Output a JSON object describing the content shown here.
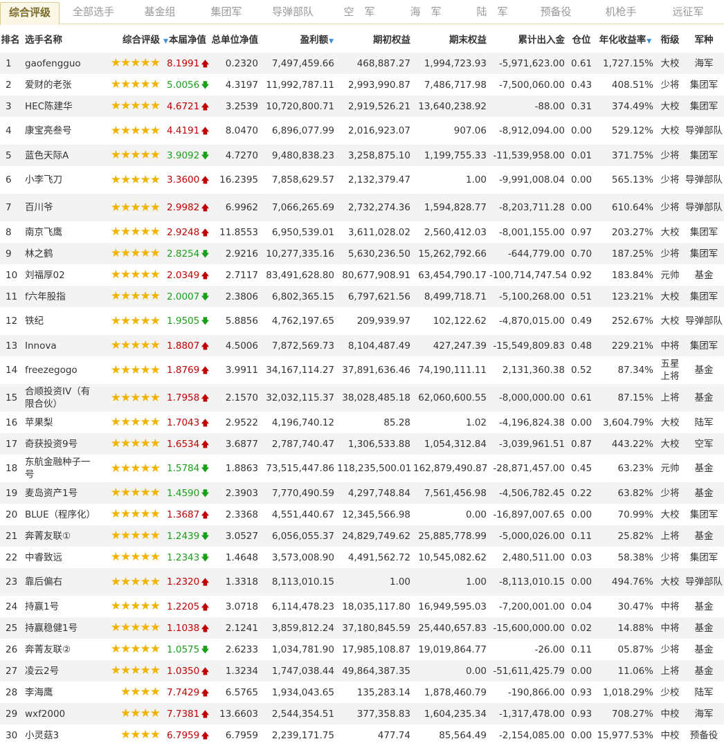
{
  "tabs": [
    "综合评级",
    "全部选手",
    "基金组",
    "集团军",
    "导弹部队",
    "空　军",
    "海　军",
    "陆　军",
    "预备役",
    "机枪手",
    "远征军"
  ],
  "headers": {
    "rank": "排名",
    "name": "选手名称",
    "rating": "综合评级",
    "nav": "本届净值",
    "total_nav": "总单位净值",
    "profit": "盈利额",
    "start_equity": "期初权益",
    "end_equity": "期末权益",
    "net_flow": "累计出入金",
    "position": "仓位",
    "annual": "年化收益率",
    "rank_title": "衔级",
    "branch": "军种"
  },
  "sort_arrow": "▼",
  "icons": {
    "star": "★",
    "up": "🡅",
    "down": "🡇"
  },
  "colors": {
    "up": "#c00000",
    "down": "#19a019",
    "star": "#f0b400"
  },
  "rows": [
    {
      "rank": "1",
      "name": "gaofengguo",
      "stars": 5,
      "nav": "8.1991",
      "dir": "up",
      "total_nav": "0.2320",
      "profit": "7,497,459.66",
      "start": "468,887.27",
      "end": "1,994,723.93",
      "flow": "-5,971,623.00",
      "pos": "0.61",
      "annual": "1,727.15%",
      "title": "大校",
      "branch": "海军"
    },
    {
      "rank": "2",
      "name": "爱财的老张",
      "stars": 5,
      "nav": "5.0056",
      "dir": "down",
      "total_nav": "4.3197",
      "profit": "11,992,787.11",
      "start": "2,993,990.87",
      "end": "7,486,717.98",
      "flow": "-7,500,060.00",
      "pos": "0.43",
      "annual": "408.51%",
      "title": "少将",
      "branch": "集团军"
    },
    {
      "rank": "3",
      "name": "HEC陈建华",
      "stars": 5,
      "nav": "4.6721",
      "dir": "up",
      "total_nav": "3.2539",
      "profit": "10,720,800.71",
      "start": "2,919,526.21",
      "end": "13,640,238.92",
      "flow": "-88.00",
      "pos": "0.31",
      "annual": "374.49%",
      "title": "大校",
      "branch": "集团军"
    },
    {
      "rank": "4",
      "name": "康宝亮叁号",
      "stars": 5,
      "nav": "4.4191",
      "dir": "up",
      "total_nav": "8.0470",
      "profit": "6,896,077.99",
      "start": "2,016,923.07",
      "end": "907.06",
      "flow": "-8,912,094.00",
      "pos": "0.00",
      "annual": "529.12%",
      "title": "大校",
      "branch": "导弹部队"
    },
    {
      "rank": "5",
      "name": "蓝色天际A",
      "stars": 5,
      "nav": "3.9092",
      "dir": "down",
      "total_nav": "4.7270",
      "profit": "9,480,838.23",
      "start": "3,258,875.10",
      "end": "1,199,755.33",
      "flow": "-11,539,958.00",
      "pos": "0.01",
      "annual": "371.75%",
      "title": "少将",
      "branch": "集团军"
    },
    {
      "rank": "6",
      "name": "小李飞刀",
      "stars": 5,
      "nav": "3.3600",
      "dir": "up",
      "total_nav": "16.2395",
      "profit": "7,858,629.57",
      "start": "2,132,379.47",
      "end": "1.00",
      "flow": "-9,991,008.04",
      "pos": "0.00",
      "annual": "565.13%",
      "title": "少将",
      "branch": "导弹部队"
    },
    {
      "rank": "7",
      "name": "百川爷",
      "stars": 5,
      "nav": "2.9982",
      "dir": "up",
      "total_nav": "6.9962",
      "profit": "7,066,265.69",
      "start": "2,732,274.36",
      "end": "1,594,828.77",
      "flow": "-8,203,711.28",
      "pos": "0.00",
      "annual": "610.64%",
      "title": "少将",
      "branch": "导弹部队"
    },
    {
      "rank": "8",
      "name": "南京飞鹰",
      "stars": 5,
      "nav": "2.9248",
      "dir": "up",
      "total_nav": "11.8553",
      "profit": "6,950,539.01",
      "start": "3,611,028.02",
      "end": "2,560,412.03",
      "flow": "-8,001,155.00",
      "pos": "0.97",
      "annual": "203.27%",
      "title": "大校",
      "branch": "集团军"
    },
    {
      "rank": "9",
      "name": "林之鹤",
      "stars": 5,
      "nav": "2.8254",
      "dir": "down",
      "total_nav": "2.9216",
      "profit": "10,277,335.16",
      "start": "5,630,236.50",
      "end": "15,262,792.66",
      "flow": "-644,779.00",
      "pos": "0.70",
      "annual": "187.25%",
      "title": "少将",
      "branch": "集团军"
    },
    {
      "rank": "10",
      "name": "刘福厚02",
      "stars": 5,
      "nav": "2.0349",
      "dir": "up",
      "total_nav": "2.7117",
      "profit": "83,491,628.80",
      "start": "80,677,908.91",
      "end": "63,454,790.17",
      "flow": "-100,714,747.54",
      "pos": "0.92",
      "annual": "183.84%",
      "title": "元帅",
      "branch": "基金"
    },
    {
      "rank": "11",
      "name": "f六年股指",
      "stars": 5,
      "nav": "2.0007",
      "dir": "down",
      "total_nav": "2.3806",
      "profit": "6,802,365.15",
      "start": "6,797,621.56",
      "end": "8,499,718.71",
      "flow": "-5,100,268.00",
      "pos": "0.51",
      "annual": "123.21%",
      "title": "大校",
      "branch": "集团军"
    },
    {
      "rank": "12",
      "name": "铁纪",
      "stars": 5,
      "nav": "1.9505",
      "dir": "down",
      "total_nav": "5.8856",
      "profit": "4,762,197.65",
      "start": "209,939.97",
      "end": "102,122.62",
      "flow": "-4,870,015.00",
      "pos": "0.49",
      "annual": "252.67%",
      "title": "大校",
      "branch": "导弹部队"
    },
    {
      "rank": "13",
      "name": "Innova",
      "stars": 5,
      "nav": "1.8807",
      "dir": "up",
      "total_nav": "4.5006",
      "profit": "7,872,569.73",
      "start": "8,104,487.49",
      "end": "427,247.39",
      "flow": "-15,549,809.83",
      "pos": "0.48",
      "annual": "229.21%",
      "title": "中将",
      "branch": "集团军"
    },
    {
      "rank": "14",
      "name": "freezegogo",
      "stars": 5,
      "nav": "1.8769",
      "dir": "up",
      "total_nav": "3.9911",
      "profit": "34,167,114.27",
      "start": "37,891,636.46",
      "end": "74,190,111.11",
      "flow": "2,131,360.38",
      "pos": "0.52",
      "annual": "87.34%",
      "title": "五星上将",
      "branch": "基金"
    },
    {
      "rank": "15",
      "name": "合顺投资IV（有限合伙）",
      "stars": 5,
      "nav": "1.7958",
      "dir": "up",
      "total_nav": "2.1570",
      "profit": "32,032,115.37",
      "start": "38,028,485.18",
      "end": "62,060,600.55",
      "flow": "-8,000,000.00",
      "pos": "0.61",
      "annual": "87.15%",
      "title": "上将",
      "branch": "基金"
    },
    {
      "rank": "16",
      "name": "苹果梨",
      "stars": 5,
      "nav": "1.7043",
      "dir": "up",
      "total_nav": "2.9522",
      "profit": "4,196,740.12",
      "start": "85.28",
      "end": "1.02",
      "flow": "-4,196,824.38",
      "pos": "0.00",
      "annual": "3,604.79%",
      "title": "大校",
      "branch": "陆军"
    },
    {
      "rank": "17",
      "name": "奇获投资9号",
      "stars": 5,
      "nav": "1.6534",
      "dir": "up",
      "total_nav": "3.6877",
      "profit": "2,787,740.47",
      "start": "1,306,533.88",
      "end": "1,054,312.84",
      "flow": "-3,039,961.51",
      "pos": "0.87",
      "annual": "443.22%",
      "title": "大校",
      "branch": "空军"
    },
    {
      "rank": "18",
      "name": "东航金融种子一号",
      "stars": 5,
      "nav": "1.5784",
      "dir": "down",
      "total_nav": "1.8863",
      "profit": "73,515,447.86",
      "start": "118,235,500.01",
      "end": "162,879,490.87",
      "flow": "-28,871,457.00",
      "pos": "0.45",
      "annual": "63.23%",
      "title": "元帅",
      "branch": "基金"
    },
    {
      "rank": "19",
      "name": "麦岛资产1号",
      "stars": 5,
      "nav": "1.4590",
      "dir": "down",
      "total_nav": "2.3903",
      "profit": "7,770,490.59",
      "start": "4,297,748.84",
      "end": "7,561,456.98",
      "flow": "-4,506,782.45",
      "pos": "0.22",
      "annual": "63.82%",
      "title": "少将",
      "branch": "基金"
    },
    {
      "rank": "20",
      "name": "BLUE（程序化）",
      "stars": 5,
      "nav": "1.3687",
      "dir": "up",
      "total_nav": "2.3368",
      "profit": "4,551,440.67",
      "start": "12,345,566.98",
      "end": "0.00",
      "flow": "-16,897,007.65",
      "pos": "0.00",
      "annual": "70.99%",
      "title": "大校",
      "branch": "集团军"
    },
    {
      "rank": "21",
      "name": "奔菁友联①",
      "stars": 5,
      "nav": "1.2439",
      "dir": "down",
      "total_nav": "3.0527",
      "profit": "6,056,055.37",
      "start": "24,829,749.62",
      "end": "25,885,778.99",
      "flow": "-5,000,026.00",
      "pos": "0.11",
      "annual": "25.82%",
      "title": "上将",
      "branch": "基金"
    },
    {
      "rank": "22",
      "name": "中睿致远",
      "stars": 5,
      "nav": "1.2343",
      "dir": "down",
      "total_nav": "1.4648",
      "profit": "3,573,008.90",
      "start": "4,491,562.72",
      "end": "10,545,082.62",
      "flow": "2,480,511.00",
      "pos": "0.03",
      "annual": "58.38%",
      "title": "少将",
      "branch": "集团军"
    },
    {
      "rank": "23",
      "name": "靠后偏右",
      "stars": 5,
      "nav": "1.2320",
      "dir": "up",
      "total_nav": "1.3318",
      "profit": "8,113,010.15",
      "start": "1.00",
      "end": "1.00",
      "flow": "-8,113,010.15",
      "pos": "0.00",
      "annual": "494.76%",
      "title": "大校",
      "branch": "导弹部队"
    },
    {
      "rank": "24",
      "name": "持赢1号",
      "stars": 5,
      "nav": "1.2205",
      "dir": "up",
      "total_nav": "3.0718",
      "profit": "6,114,478.23",
      "start": "18,035,117.80",
      "end": "16,949,595.03",
      "flow": "-7,200,001.00",
      "pos": "0.04",
      "annual": "30.47%",
      "title": "中将",
      "branch": "基金"
    },
    {
      "rank": "25",
      "name": "持赢稳健1号",
      "stars": 5,
      "nav": "1.1038",
      "dir": "up",
      "total_nav": "2.1241",
      "profit": "3,859,812.24",
      "start": "37,180,845.59",
      "end": "25,440,657.83",
      "flow": "-15,600,000.00",
      "pos": "0.02",
      "annual": "14.88%",
      "title": "中将",
      "branch": "基金"
    },
    {
      "rank": "26",
      "name": "奔菁友联②",
      "stars": 5,
      "nav": "1.0575",
      "dir": "down",
      "total_nav": "2.6233",
      "profit": "1,034,781.90",
      "start": "17,985,108.87",
      "end": "19,019,864.77",
      "flow": "-26.00",
      "pos": "0.11",
      "annual": "05.87%",
      "title": "少将",
      "branch": "基金"
    },
    {
      "rank": "27",
      "name": "凌云2号",
      "stars": 5,
      "nav": "1.0350",
      "dir": "up",
      "total_nav": "1.3234",
      "profit": "1,747,038.44",
      "start": "49,864,387.35",
      "end": "0.00",
      "flow": "-51,611,425.79",
      "pos": "0.00",
      "annual": "11.06%",
      "title": "上将",
      "branch": "基金"
    },
    {
      "rank": "28",
      "name": "李海鹰",
      "stars": 4,
      "nav": "7.7429",
      "dir": "up",
      "total_nav": "6.5765",
      "profit": "1,934,043.65",
      "start": "135,283.14",
      "end": "1,878,460.79",
      "flow": "-190,866.00",
      "pos": "0.93",
      "annual": "1,018.29%",
      "title": "少校",
      "branch": "陆军"
    },
    {
      "rank": "29",
      "name": "wxf2000",
      "stars": 4,
      "nav": "7.7381",
      "dir": "up",
      "total_nav": "13.6603",
      "profit": "2,544,354.51",
      "start": "377,358.83",
      "end": "1,604,235.34",
      "flow": "-1,317,478.00",
      "pos": "0.93",
      "annual": "708.27%",
      "title": "中校",
      "branch": "海军"
    },
    {
      "rank": "30",
      "name": "小灵菇3",
      "stars": 4,
      "nav": "6.7959",
      "dir": "up",
      "total_nav": "6.7959",
      "profit": "2,239,171.75",
      "start": "477.74",
      "end": "85,564.49",
      "flow": "-2,154,085.00",
      "pos": "0.00",
      "annual": "15,977.53%",
      "title": "中校",
      "branch": "预备役"
    }
  ]
}
